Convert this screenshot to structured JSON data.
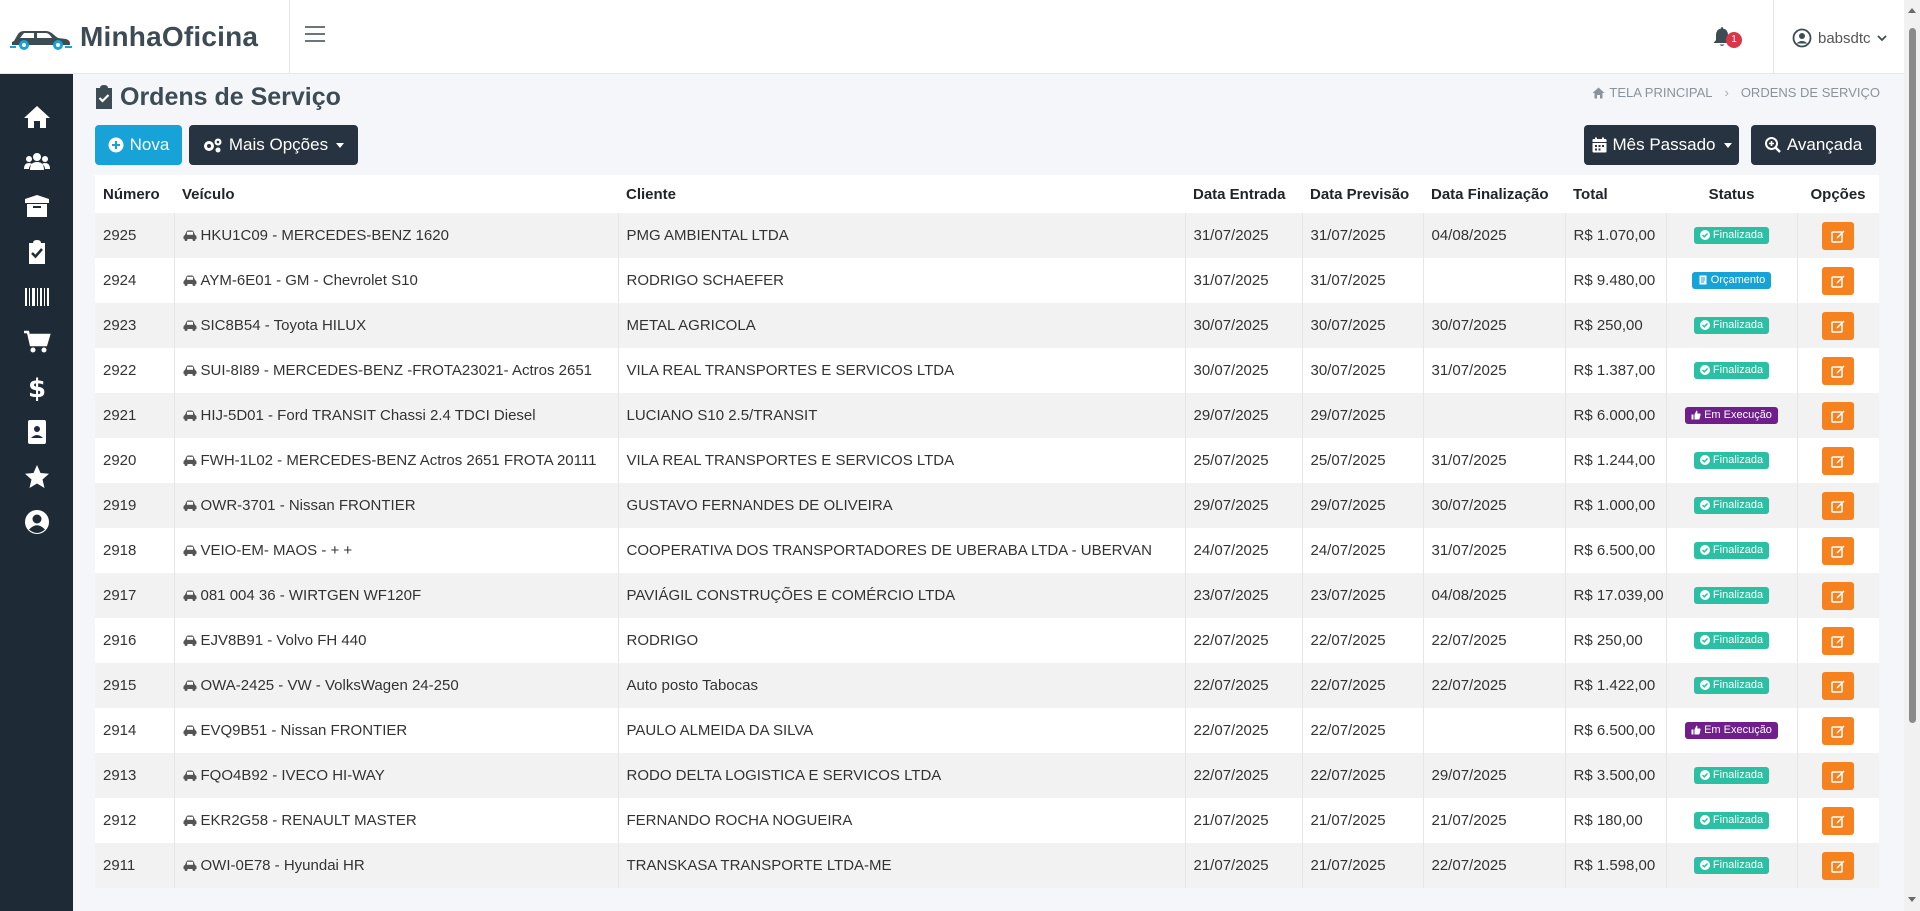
{
  "brand": {
    "name": "MinhaOficina"
  },
  "header": {
    "notification_count": "1",
    "username": "babsdtc"
  },
  "sidebar": {
    "items": [
      {
        "name": "home-icon"
      },
      {
        "name": "users-icon"
      },
      {
        "name": "box-icon"
      },
      {
        "name": "clipboard-check-icon"
      },
      {
        "name": "barcode-icon"
      },
      {
        "name": "cart-icon"
      },
      {
        "name": "dollar-icon"
      },
      {
        "name": "contact-icon"
      },
      {
        "name": "star-icon"
      },
      {
        "name": "user-circle-icon"
      }
    ]
  },
  "page": {
    "title": "Ordens de Serviço",
    "breadcrumb": {
      "home": "TELA PRINCIPAL",
      "current": "ORDENS DE SERVIÇO"
    }
  },
  "toolbar": {
    "nova": "Nova",
    "mais_opcoes": "Mais Opções",
    "mes_passado": "Mês Passado",
    "avancada": "Avançada"
  },
  "table": {
    "headers": [
      "Número",
      "Veículo",
      "Cliente",
      "Data Entrada",
      "Data Previsão",
      "Data Finalização",
      "Total",
      "Status",
      "Opções"
    ],
    "rows": [
      {
        "numero": "2925",
        "veiculo": "HKU1C09 - MERCEDES-BENZ 1620",
        "cliente": "PMG AMBIENTAL LTDA",
        "entrada": "31/07/2025",
        "previsao": "31/07/2025",
        "finalizacao": "04/08/2025",
        "total": "R$ 1.070,00",
        "status": "Finalizada",
        "status_type": "fin"
      },
      {
        "numero": "2924",
        "veiculo": "AYM-6E01 - GM - Chevrolet S10",
        "cliente": "RODRIGO SCHAEFER",
        "entrada": "31/07/2025",
        "previsao": "31/07/2025",
        "finalizacao": "",
        "total": "R$ 9.480,00",
        "status": "Orçamento",
        "status_type": "orc"
      },
      {
        "numero": "2923",
        "veiculo": "SIC8B54 - Toyota HILUX",
        "cliente": "METAL AGRICOLA",
        "entrada": "30/07/2025",
        "previsao": "30/07/2025",
        "finalizacao": "30/07/2025",
        "total": "R$ 250,00",
        "status": "Finalizada",
        "status_type": "fin"
      },
      {
        "numero": "2922",
        "veiculo": "SUI-8I89 - MERCEDES-BENZ -FROTA23021- Actros 2651",
        "cliente": "VILA REAL TRANSPORTES E SERVICOS LTDA",
        "entrada": "30/07/2025",
        "previsao": "30/07/2025",
        "finalizacao": "31/07/2025",
        "total": "R$ 1.387,00",
        "status": "Finalizada",
        "status_type": "fin"
      },
      {
        "numero": "2921",
        "veiculo": "HIJ-5D01 - Ford TRANSIT Chassi 2.4 TDCI Diesel",
        "cliente": "LUCIANO S10 2.5/TRANSIT",
        "entrada": "29/07/2025",
        "previsao": "29/07/2025",
        "finalizacao": "",
        "total": "R$ 6.000,00",
        "status": "Em Execução",
        "status_type": "exe"
      },
      {
        "numero": "2920",
        "veiculo": "FWH-1L02 - MERCEDES-BENZ Actros 2651 FROTA 20111",
        "cliente": "VILA REAL TRANSPORTES E SERVICOS LTDA",
        "entrada": "25/07/2025",
        "previsao": "25/07/2025",
        "finalizacao": "31/07/2025",
        "total": "R$ 1.244,00",
        "status": "Finalizada",
        "status_type": "fin"
      },
      {
        "numero": "2919",
        "veiculo": "OWR-3701 - Nissan FRONTIER",
        "cliente": "GUSTAVO FERNANDES DE OLIVEIRA",
        "entrada": "29/07/2025",
        "previsao": "29/07/2025",
        "finalizacao": "30/07/2025",
        "total": "R$ 1.000,00",
        "status": "Finalizada",
        "status_type": "fin"
      },
      {
        "numero": "2918",
        "veiculo": "VEIO-EM- MAOS - + +",
        "cliente": "COOPERATIVA DOS TRANSPORTADORES DE UBERABA LTDA - UBERVAN",
        "entrada": "24/07/2025",
        "previsao": "24/07/2025",
        "finalizacao": "31/07/2025",
        "total": "R$ 6.500,00",
        "status": "Finalizada",
        "status_type": "fin"
      },
      {
        "numero": "2917",
        "veiculo": "081 004 36 - WIRTGEN WF120F",
        "cliente": "PAVIÁGIL CONSTRUÇÕES E COMÉRCIO LTDA",
        "entrada": "23/07/2025",
        "previsao": "23/07/2025",
        "finalizacao": "04/08/2025",
        "total": "R$ 17.039,00",
        "status": "Finalizada",
        "status_type": "fin"
      },
      {
        "numero": "2916",
        "veiculo": "EJV8B91 - Volvo FH 440",
        "cliente": "RODRIGO",
        "entrada": "22/07/2025",
        "previsao": "22/07/2025",
        "finalizacao": "22/07/2025",
        "total": "R$ 250,00",
        "status": "Finalizada",
        "status_type": "fin"
      },
      {
        "numero": "2915",
        "veiculo": "OWA-2425 - VW - VolksWagen 24-250",
        "cliente": "Auto posto Tabocas",
        "entrada": "22/07/2025",
        "previsao": "22/07/2025",
        "finalizacao": "22/07/2025",
        "total": "R$ 1.422,00",
        "status": "Finalizada",
        "status_type": "fin"
      },
      {
        "numero": "2914",
        "veiculo": "EVQ9B51 - Nissan FRONTIER",
        "cliente": "PAULO ALMEIDA DA SILVA",
        "entrada": "22/07/2025",
        "previsao": "22/07/2025",
        "finalizacao": "",
        "total": "R$ 6.500,00",
        "status": "Em Execução",
        "status_type": "exe"
      },
      {
        "numero": "2913",
        "veiculo": "FQO4B92 - IVECO HI-WAY",
        "cliente": "RODO DELTA LOGISTICA E SERVICOS LTDA",
        "entrada": "22/07/2025",
        "previsao": "22/07/2025",
        "finalizacao": "29/07/2025",
        "total": "R$ 3.500,00",
        "status": "Finalizada",
        "status_type": "fin"
      },
      {
        "numero": "2912",
        "veiculo": "EKR2G58 - RENAULT MASTER",
        "cliente": "FERNANDO ROCHA NOGUEIRA",
        "entrada": "21/07/2025",
        "previsao": "21/07/2025",
        "finalizacao": "21/07/2025",
        "total": "R$ 180,00",
        "status": "Finalizada",
        "status_type": "fin"
      },
      {
        "numero": "2911",
        "veiculo": "OWI-0E78 - Hyundai HR",
        "cliente": "TRANSKASA TRANSPORTE LTDA-ME",
        "entrada": "21/07/2025",
        "previsao": "21/07/2025",
        "finalizacao": "22/07/2025",
        "total": "R$ 1.598,00",
        "status": "Finalizada",
        "status_type": "fin"
      }
    ]
  },
  "colors": {
    "sidebar": "#1e2a36",
    "primary": "#17a2d8",
    "dark_button": "#273340",
    "finalizada": "#2bc0a4",
    "orcamento": "#17a2d8",
    "em_execucao": "#6f1e8c",
    "edit": "#f5821f"
  }
}
